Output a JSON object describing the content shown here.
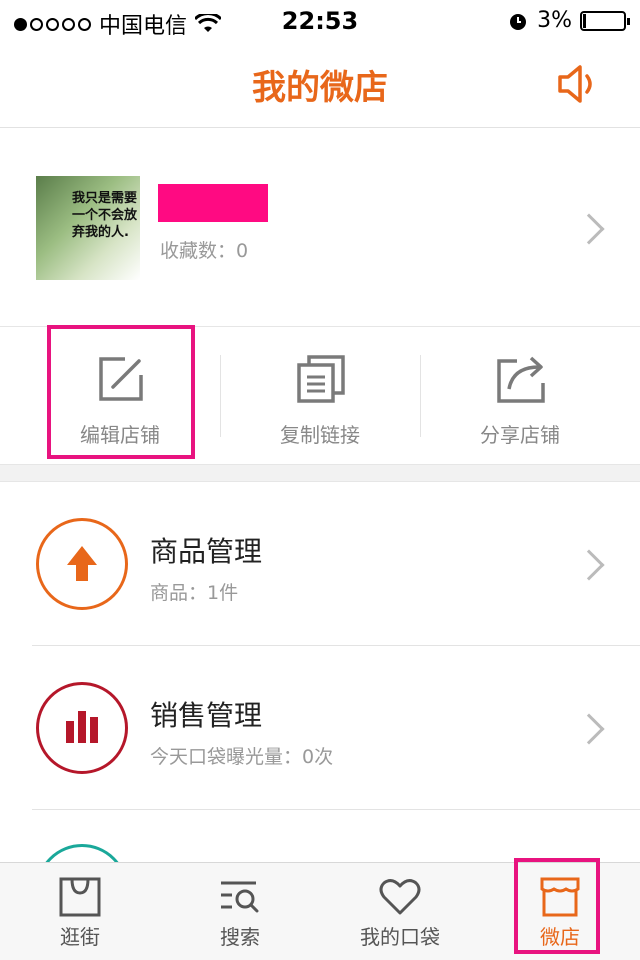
{
  "status_bar": {
    "carrier": "中国电信",
    "time": "22:53",
    "battery": "3%"
  },
  "header": {
    "title": "我的微店"
  },
  "store": {
    "avatar_text": "我只是需要一个不会放弃我的人.",
    "favorites_label": "收藏数：0"
  },
  "actions": [
    {
      "label": "编辑店铺"
    },
    {
      "label": "复制链接"
    },
    {
      "label": "分享店铺"
    }
  ],
  "management": [
    {
      "title": "商品管理",
      "subtitle": "商品：1件",
      "color": "#e8671a"
    },
    {
      "title": "销售管理",
      "subtitle": "今天口袋曝光量：0次",
      "color": "#b5172a"
    }
  ],
  "tabs": [
    {
      "label": "逛街"
    },
    {
      "label": "搜索"
    },
    {
      "label": "我的口袋"
    },
    {
      "label": "微店"
    }
  ],
  "colors": {
    "accent": "#e8671a",
    "highlight": "#e8137f",
    "name_block": "#ff0a82",
    "teal": "#1aa89a"
  }
}
